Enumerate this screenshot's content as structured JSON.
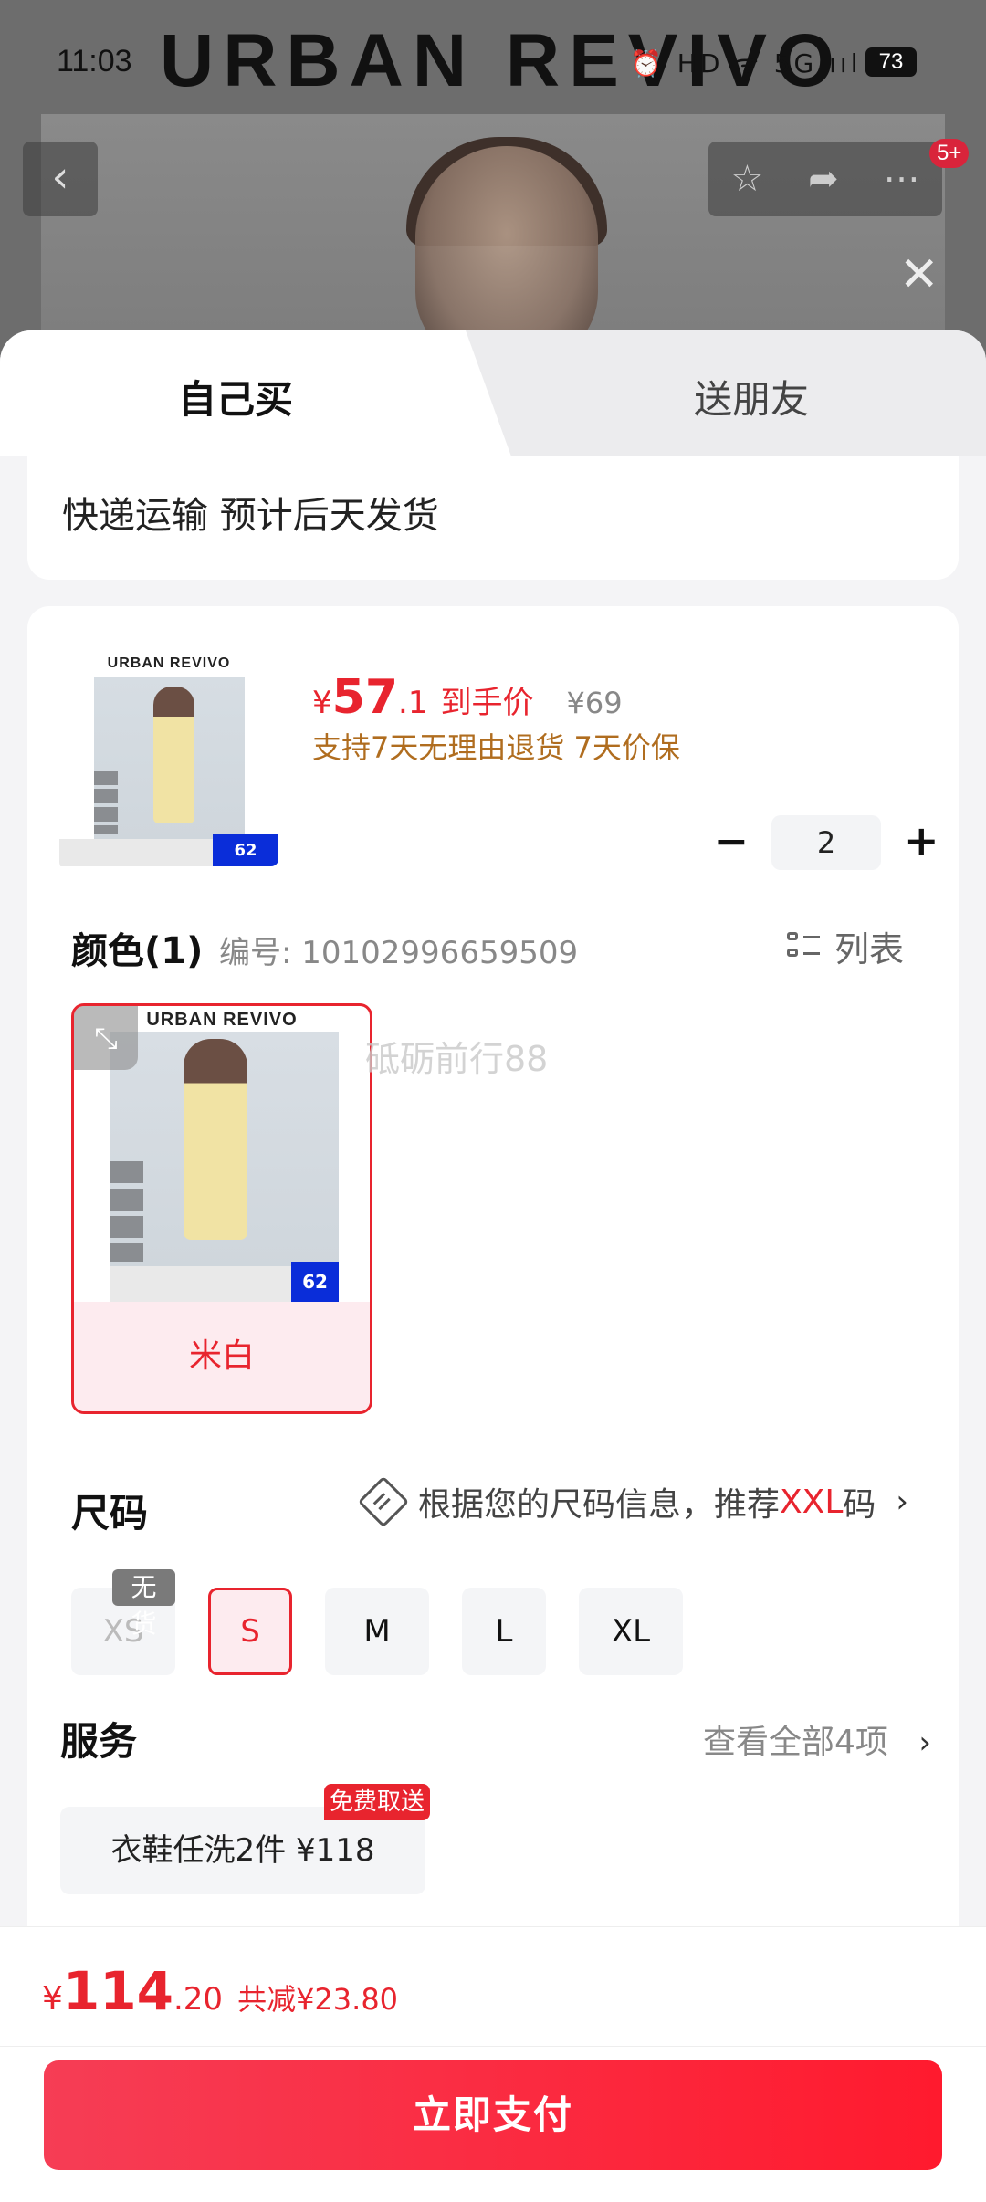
{
  "status_bar": {
    "time": "11:03",
    "icons": "⏰ HD ᯤ 5G ııl",
    "battery": "73"
  },
  "background": {
    "brand": "URBAN REVIVO",
    "badge": "5+"
  },
  "tabs": {
    "self": "自己买",
    "friend": "送朋友"
  },
  "shipping": {
    "text": "快递运输 预计后天发货"
  },
  "product": {
    "thumb_brand": "URBAN REVIVO",
    "thumb_sale": "62",
    "price_currency": "¥",
    "price_main": "57",
    "price_decimal": ".1",
    "price_label": "到手价",
    "original_price": "¥69",
    "policy": "支持7天无理由退货 7天价保",
    "quantity": "2"
  },
  "color": {
    "title": "颜色(1)",
    "code": "编号: 10102996659509",
    "list_label": "列表",
    "swatch_brand": "URBAN REVIVO",
    "swatch_sale": "62",
    "swatch_label": "米白",
    "watermark": "砥砺前行88"
  },
  "size": {
    "title": "尺码",
    "rec_prefix": "根据您的尺码信息，推荐",
    "rec_size": "XXL",
    "rec_suffix": "码",
    "no_stock": "无货",
    "options": [
      "XS",
      "S",
      "M",
      "L",
      "XL"
    ],
    "selected": "S"
  },
  "service": {
    "title": "服务",
    "view_all": "查看全部4项",
    "chip": "衣鞋任洗2件 ¥118",
    "badge": "免费取送"
  },
  "bottom": {
    "currency": "¥",
    "total_main": "114",
    "total_decimal": ".20",
    "savings": "共减¥23.80",
    "pay_button": "立即支付"
  },
  "colors": {
    "accent": "#e8242e",
    "policy": "#b06d1f",
    "selected_bg": "#fdebef"
  }
}
